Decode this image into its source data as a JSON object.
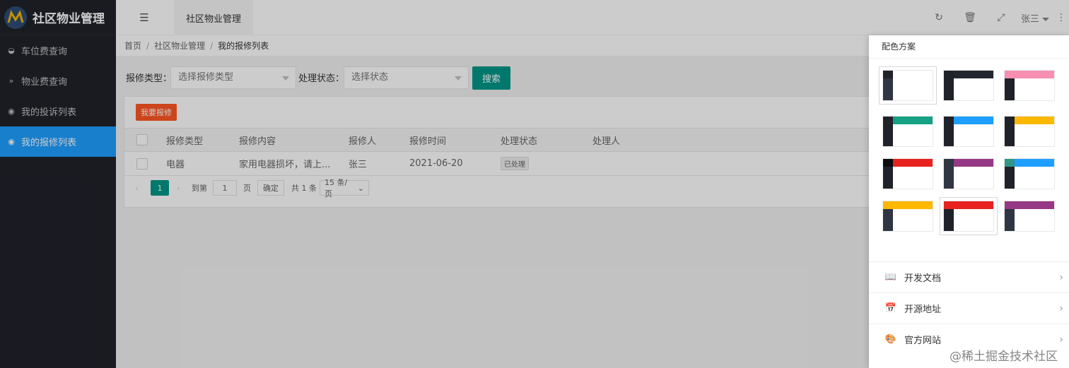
{
  "app": {
    "title": "社区物业管理"
  },
  "sidebar": {
    "items": [
      {
        "label": "车位费查询",
        "icon": "dashboard-icon"
      },
      {
        "label": "物业费查询",
        "icon": "double-chevron-icon"
      },
      {
        "label": "我的投诉列表",
        "icon": "circle-dot-icon"
      },
      {
        "label": "我的报修列表",
        "icon": "circle-dot-icon",
        "active": true
      }
    ]
  },
  "header": {
    "tab": "社区物业管理",
    "user": "张三"
  },
  "breadcrumb": [
    "首页",
    "社区物业管理",
    "我的报修列表"
  ],
  "filters": {
    "type_label": "报修类型：",
    "type_placeholder": "选择报修类型",
    "status_label": "处理状态：",
    "status_placeholder": "选择状态",
    "search_label": "搜索"
  },
  "table": {
    "add_label": "我要报修",
    "columns": [
      "报修类型",
      "报修内容",
      "报修人",
      "报修时间",
      "处理状态",
      "处理人"
    ],
    "rows": [
      {
        "type": "电器",
        "content": "家用电器损坏，请上...",
        "person": "张三",
        "time": "2021-06-20",
        "status": "已处理",
        "handler": ""
      }
    ]
  },
  "pagination": {
    "current": "1",
    "goto_label": "到第",
    "goto_value": "1",
    "page_label": "页",
    "confirm_label": "确定",
    "total_label": "共 1 条",
    "per_page": "15 条/页"
  },
  "drawer": {
    "title": "配色方案",
    "themes": [
      {
        "logo": "#20222a",
        "side": "#2f3542",
        "head": "#ffffff"
      },
      {
        "logo": "#20222a",
        "side": "#20222a",
        "head": "#23262e"
      },
      {
        "logo": "#f78fb3",
        "side": "#20222a",
        "head": "#f78fb3"
      },
      {
        "logo": "#20222a",
        "side": "#20222a",
        "head": "#16a085"
      },
      {
        "logo": "#20222a",
        "side": "#20222a",
        "head": "#1e9fff"
      },
      {
        "logo": "#20222a",
        "side": "#20222a",
        "head": "#ffb800"
      },
      {
        "logo": "#0c0c0c",
        "side": "#20222a",
        "head": "#e82121"
      },
      {
        "logo": "#2f3542",
        "side": "#2f3542",
        "head": "#963885"
      },
      {
        "logo": "#2f9688",
        "side": "#20222a",
        "head": "#1e9fff"
      },
      {
        "logo": "#ffb800",
        "side": "#2f3542",
        "head": "#ffb800"
      },
      {
        "logo": "#e82121",
        "side": "#20222a",
        "head": "#e82121"
      },
      {
        "logo": "#963885",
        "side": "#2f3542",
        "head": "#963885"
      }
    ],
    "links": [
      {
        "label": "开发文档",
        "icon": "book-icon"
      },
      {
        "label": "开源地址",
        "icon": "calendar-icon"
      },
      {
        "label": "官方网站",
        "icon": "palette-icon"
      }
    ]
  },
  "watermark": "@稀土掘金技术社区"
}
